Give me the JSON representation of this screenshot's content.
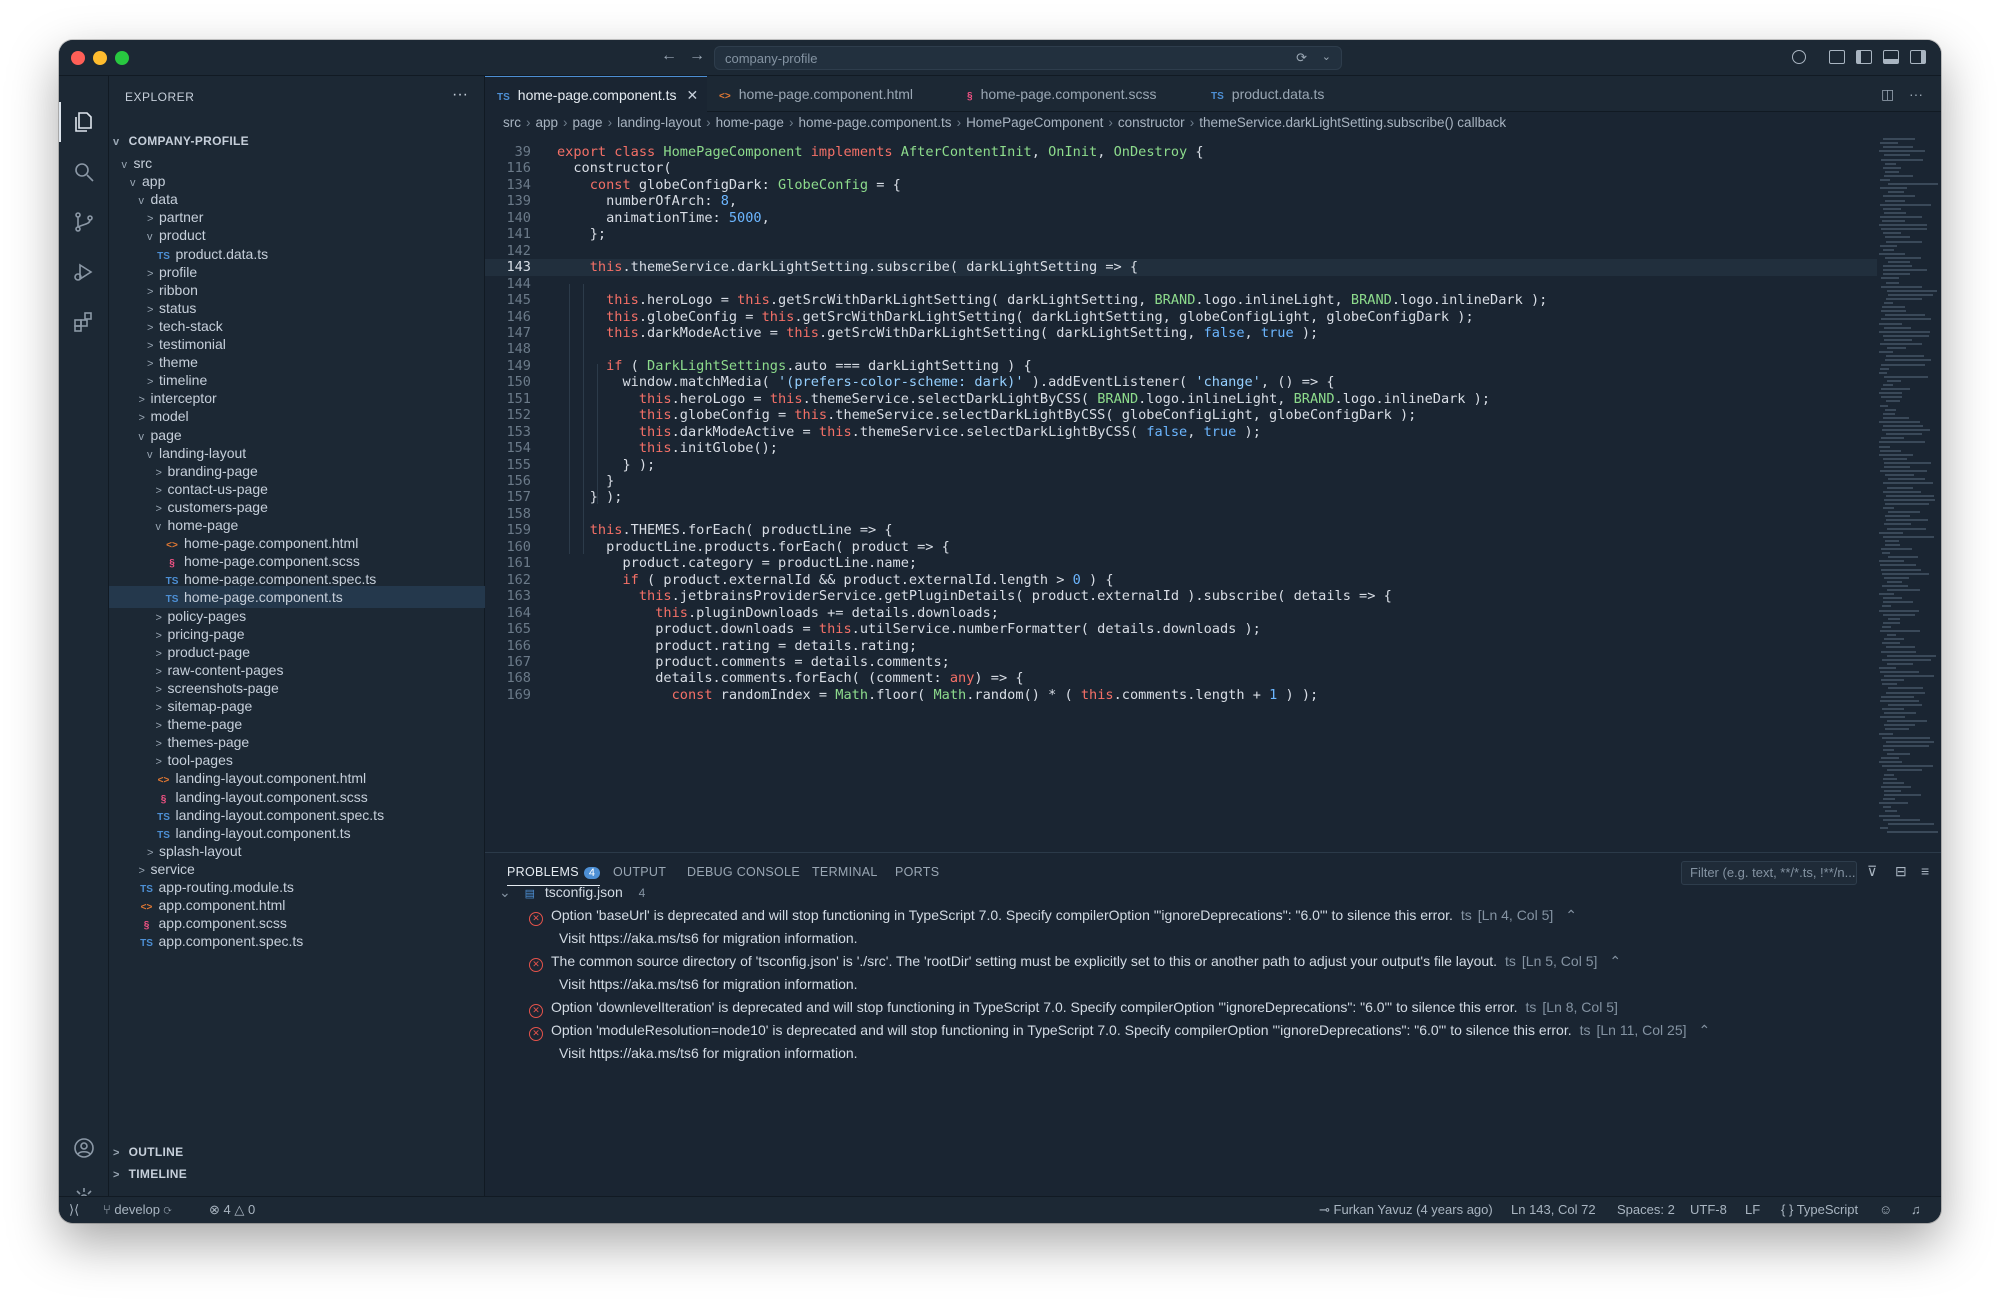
{
  "titlebar": {
    "search": "company-profile"
  },
  "explorer": {
    "title": "EXPLORER",
    "root": "COMPANY-PROFILE",
    "items": [
      {
        "label": "src",
        "chev": "v",
        "icon": ""
      },
      {
        "label": "app",
        "chev": "v",
        "icon": ""
      },
      {
        "label": "data",
        "chev": "v",
        "icon": ""
      },
      {
        "label": "partner",
        "chev": ">",
        "icon": ""
      },
      {
        "label": "product",
        "chev": "v",
        "icon": ""
      },
      {
        "label": "product.data.ts",
        "chev": "",
        "icon": "TS"
      },
      {
        "label": "profile",
        "chev": ">",
        "icon": ""
      },
      {
        "label": "ribbon",
        "chev": ">",
        "icon": ""
      },
      {
        "label": "status",
        "chev": ">",
        "icon": ""
      },
      {
        "label": "tech-stack",
        "chev": ">",
        "icon": ""
      },
      {
        "label": "testimonial",
        "chev": ">",
        "icon": ""
      },
      {
        "label": "theme",
        "chev": ">",
        "icon": ""
      },
      {
        "label": "timeline",
        "chev": ">",
        "icon": ""
      },
      {
        "label": "interceptor",
        "chev": ">",
        "icon": ""
      },
      {
        "label": "model",
        "chev": ">",
        "icon": ""
      },
      {
        "label": "page",
        "chev": "v",
        "icon": ""
      },
      {
        "label": "landing-layout",
        "chev": "v",
        "icon": ""
      },
      {
        "label": "branding-page",
        "chev": ">",
        "icon": ""
      },
      {
        "label": "contact-us-page",
        "chev": ">",
        "icon": ""
      },
      {
        "label": "customers-page",
        "chev": ">",
        "icon": ""
      },
      {
        "label": "home-page",
        "chev": "v",
        "icon": ""
      },
      {
        "label": "home-page.component.html",
        "chev": "",
        "icon": "<>"
      },
      {
        "label": "home-page.component.scss",
        "chev": "",
        "icon": "§"
      },
      {
        "label": "home-page.component.spec.ts",
        "chev": "",
        "icon": "TS"
      },
      {
        "label": "home-page.component.ts",
        "chev": "",
        "icon": "TS"
      },
      {
        "label": "policy-pages",
        "chev": ">",
        "icon": ""
      },
      {
        "label": "pricing-page",
        "chev": ">",
        "icon": ""
      },
      {
        "label": "product-page",
        "chev": ">",
        "icon": ""
      },
      {
        "label": "raw-content-pages",
        "chev": ">",
        "icon": ""
      },
      {
        "label": "screenshots-page",
        "chev": ">",
        "icon": ""
      },
      {
        "label": "sitemap-page",
        "chev": ">",
        "icon": ""
      },
      {
        "label": "theme-page",
        "chev": ">",
        "icon": ""
      },
      {
        "label": "themes-page",
        "chev": ">",
        "icon": ""
      },
      {
        "label": "tool-pages",
        "chev": ">",
        "icon": ""
      },
      {
        "label": "landing-layout.component.html",
        "chev": "",
        "icon": "<>"
      },
      {
        "label": "landing-layout.component.scss",
        "chev": "",
        "icon": "§"
      },
      {
        "label": "landing-layout.component.spec.ts",
        "chev": "",
        "icon": "TS"
      },
      {
        "label": "landing-layout.component.ts",
        "chev": "",
        "icon": "TS"
      },
      {
        "label": "splash-layout",
        "chev": ">",
        "icon": ""
      },
      {
        "label": "service",
        "chev": ">",
        "icon": ""
      },
      {
        "label": "app-routing.module.ts",
        "chev": "",
        "icon": "TS"
      },
      {
        "label": "app.component.html",
        "chev": "",
        "icon": "<>"
      },
      {
        "label": "app.component.scss",
        "chev": "",
        "icon": "§"
      },
      {
        "label": "app.component.spec.ts",
        "chev": "",
        "icon": "TS"
      }
    ],
    "outline": "OUTLINE",
    "timeline": "TIMELINE"
  },
  "tabs": [
    {
      "icon": "TS",
      "label": "home-page.component.ts",
      "active": true
    },
    {
      "icon": "<>",
      "label": "home-page.component.html"
    },
    {
      "icon": "§",
      "label": "home-page.component.scss"
    },
    {
      "icon": "TS",
      "label": "product.data.ts"
    }
  ],
  "breadcrumbs": [
    "src",
    "app",
    "page",
    "landing-layout",
    "home-page",
    "home-page.component.ts",
    "HomePageComponent",
    "constructor",
    "themeService.darkLightSetting.subscribe() callback"
  ],
  "editor": {
    "line_numbers": [
      "39",
      "116",
      "134",
      "139",
      "140",
      "141",
      "142",
      "143",
      "144",
      "145",
      "146",
      "147",
      "148",
      "149",
      "150",
      "151",
      "152",
      "153",
      "154",
      "155",
      "156",
      "157",
      "158",
      "159",
      "160",
      "161",
      "162",
      "163",
      "164",
      "165",
      "166",
      "167",
      "168",
      "169"
    ],
    "current_line": "143",
    "lines": [
      "export class HomePageComponent implements AfterContentInit, OnInit, OnDestroy {",
      "  constructor(",
      "    const globeConfigDark: GlobeConfig = {",
      "      numberOfArch: 8,",
      "      animationTime: 5000,",
      "    };",
      "",
      "    this.themeService.darkLightSetting.subscribe( darkLightSetting => {",
      "",
      "      this.heroLogo = this.getSrcWithDarkLightSetting( darkLightSetting, BRAND.logo.inlineLight, BRAND.logo.inlineDark );",
      "      this.globeConfig = this.getSrcWithDarkLightSetting( darkLightSetting, globeConfigLight, globeConfigDark );",
      "      this.darkModeActive = this.getSrcWithDarkLightSetting( darkLightSetting, false, true );",
      "",
      "      if ( DarkLightSettings.auto === darkLightSetting ) {",
      "        window.matchMedia( '(prefers-color-scheme: dark)' ).addEventListener( 'change', () => {",
      "          this.heroLogo = this.themeService.selectDarkLightByCSS( BRAND.logo.inlineLight, BRAND.logo.inlineDark );",
      "          this.globeConfig = this.themeService.selectDarkLightByCSS( globeConfigLight, globeConfigDark );",
      "          this.darkModeActive = this.themeService.selectDarkLightByCSS( false, true );",
      "          this.initGlobe();",
      "        } );",
      "      }",
      "    } );",
      "",
      "    this.THEMES.forEach( productLine => {",
      "      productLine.products.forEach( product => {",
      "        product.category = productLine.name;",
      "        if ( product.externalId && product.externalId.length > 0 ) {",
      "          this.jetbrainsProviderService.getPluginDetails( product.externalId ).subscribe( details => {",
      "            this.pluginDownloads += details.downloads;",
      "            product.downloads = this.utilService.numberFormatter( details.downloads );",
      "            product.rating = details.rating;",
      "            product.comments = details.comments;",
      "            details.comments.forEach( (comment: any) => {",
      "              const randomIndex = Math.floor( Math.random() * ( this.comments.length + 1 ) );"
    ]
  },
  "panel": {
    "tabs": [
      "PROBLEMS",
      "OUTPUT",
      "DEBUG CONSOLE",
      "TERMINAL",
      "PORTS"
    ],
    "problems_count": "4",
    "filter_placeholder": "Filter (e.g. text, **/*.ts, !**/n...",
    "file": {
      "name": "tsconfig.json",
      "count": "4"
    },
    "problems": [
      {
        "message": "Option 'baseUrl' is deprecated and will stop functioning in TypeScript 7.0. Specify compilerOption '\"ignoreDeprecations\": \"6.0\"' to silence this error.",
        "source": "ts",
        "location": "[Ln 4, Col 5]",
        "detail": "Visit https://aka.ms/ts6 for migration information."
      },
      {
        "message": "The common source directory of 'tsconfig.json' is './src'. The 'rootDir' setting must be explicitly set to this or another path to adjust your output's file layout.",
        "source": "ts",
        "location": "[Ln 5, Col 5]",
        "detail": "Visit https://aka.ms/ts6 for migration information."
      },
      {
        "message": "Option 'downlevelIteration' is deprecated and will stop functioning in TypeScript 7.0. Specify compilerOption '\"ignoreDeprecations\": \"6.0\"' to silence this error.",
        "source": "ts",
        "location": "[Ln 8, Col 5]",
        "detail": ""
      },
      {
        "message": "Option 'moduleResolution=node10' is deprecated and will stop functioning in TypeScript 7.0. Specify compilerOption '\"ignoreDeprecations\": \"6.0\"' to silence this error.",
        "source": "ts",
        "location": "[Ln 11, Col 25]",
        "detail": "Visit https://aka.ms/ts6 for migration information."
      }
    ]
  },
  "statusbar": {
    "branch": "develop",
    "errors": "4",
    "warnings": "0",
    "blame": "Furkan Yavuz (4 years ago)",
    "position": "Ln 143, Col 72",
    "spaces": "Spaces: 2",
    "encoding": "UTF-8",
    "eol": "LF",
    "language": "TypeScript"
  },
  "colors": {
    "accent": "#4d8fd4",
    "error": "#e5534b",
    "background": "#1a2532"
  }
}
